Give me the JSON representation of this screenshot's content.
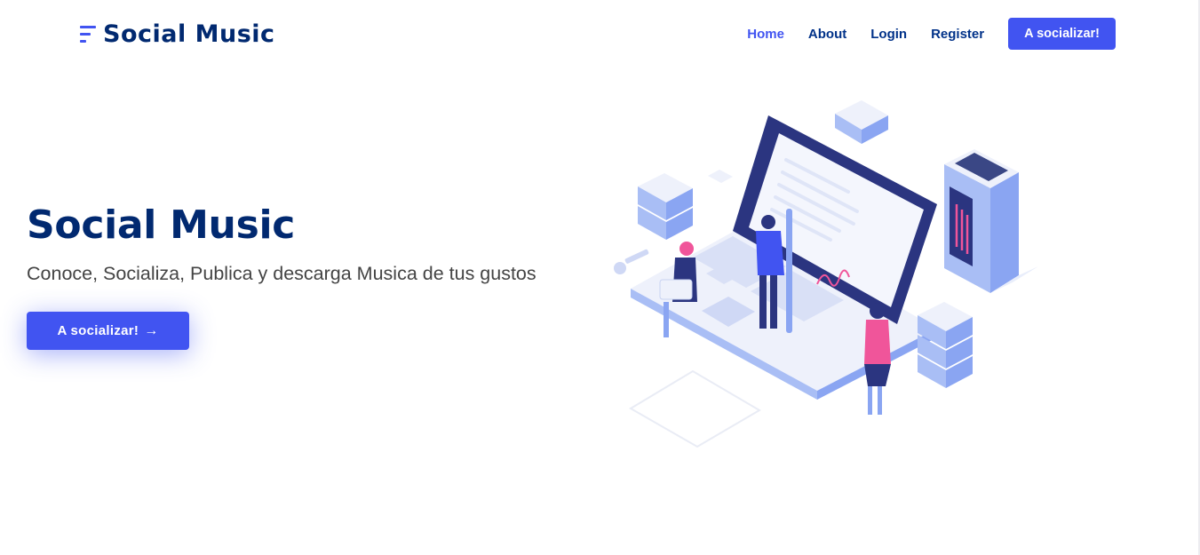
{
  "header": {
    "brand": "Social Music",
    "nav": [
      {
        "label": "Home",
        "active": true
      },
      {
        "label": "About",
        "active": false
      },
      {
        "label": "Login",
        "active": false
      },
      {
        "label": "Register",
        "active": false
      }
    ],
    "cta_label": "A socializar!"
  },
  "hero": {
    "title": "Social Music",
    "subtitle": "Conoce, Socializa, Publica y descarga Musica de tus gustos",
    "button_label": "A socializar!",
    "button_icon": "arrow-right-icon"
  },
  "colors": {
    "accent": "#4154f1",
    "heading": "#012970",
    "nav_text": "#013289",
    "body_text": "#444444"
  }
}
